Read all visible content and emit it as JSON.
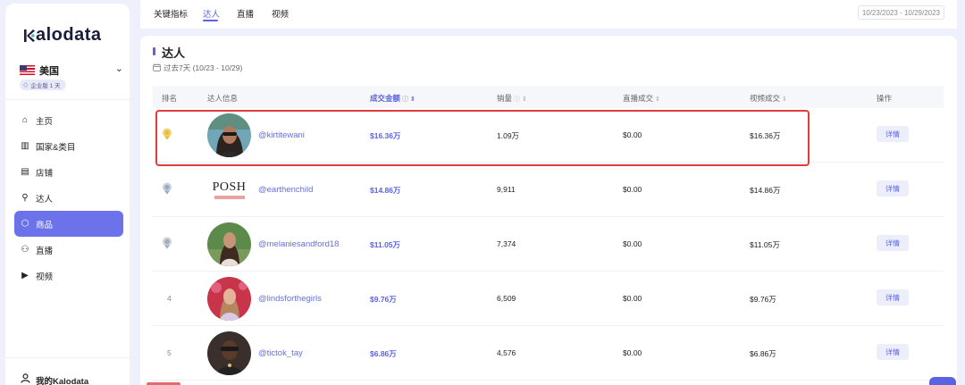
{
  "app": {
    "logo_text": "Kalodata"
  },
  "region": {
    "name": "美国",
    "plan": "企业版 1 天"
  },
  "sidebar": {
    "items": [
      {
        "label": "主页",
        "icon": "home-icon",
        "glyph": "⌂"
      },
      {
        "label": "国家&类目",
        "icon": "bank-icon",
        "glyph": "▥"
      },
      {
        "label": "店铺",
        "icon": "shop-icon",
        "glyph": "▤"
      },
      {
        "label": "达人",
        "icon": "person-pin-icon",
        "glyph": "⚲"
      },
      {
        "label": "商品",
        "icon": "box-icon",
        "glyph": "⬡"
      },
      {
        "label": "直播",
        "icon": "broadcast-icon",
        "glyph": "⚇"
      },
      {
        "label": "视频",
        "icon": "video-icon",
        "glyph": "▶"
      }
    ],
    "active_index": 4,
    "footer": "我的Kalodata"
  },
  "tabs": [
    {
      "label": "关键指标"
    },
    {
      "label": "达人"
    },
    {
      "label": "直播"
    },
    {
      "label": "视频"
    }
  ],
  "active_tab": 1,
  "date_range": "10/23/2023 - 10/29/2023",
  "section": {
    "title": "达人",
    "subtitle": "过去7天 (10/23 - 10/29)"
  },
  "table": {
    "headers": {
      "rank": "排名",
      "creator": "达人信息",
      "gmv": "成交金额",
      "units": "销量",
      "live": "直播成交",
      "video": "视频成交",
      "action": "操作"
    },
    "rows": [
      {
        "rank": "",
        "handle": "@kirtitewani",
        "gmv": "$16.36万",
        "units": "1.09万",
        "live": "$0.00",
        "video": "$16.36万",
        "action": "详情"
      },
      {
        "rank": "",
        "handle": "@earthenchild",
        "gmv": "$14.86万",
        "units": "9,911",
        "live": "$0.00",
        "video": "$14.86万",
        "action": "详情"
      },
      {
        "rank": "",
        "handle": "@melaniesandford18",
        "gmv": "$11.05万",
        "units": "7,374",
        "live": "$0.00",
        "video": "$11.05万",
        "action": "详情"
      },
      {
        "rank": "4",
        "handle": "@lindsforthegirls",
        "gmv": "$9.76万",
        "units": "6,509",
        "live": "$0.00",
        "video": "$9.76万",
        "action": "详情"
      },
      {
        "rank": "5",
        "handle": "@tictok_tay",
        "gmv": "$6.86万",
        "units": "4,576",
        "live": "$0.00",
        "video": "$6.86万",
        "action": "详情"
      }
    ],
    "posh_logo_text": "POSH"
  },
  "colors": {
    "accent": "#5b64e0",
    "highlight": "#e23b3b",
    "gold": "#e8b93a",
    "silver": "#a9b6c9"
  }
}
